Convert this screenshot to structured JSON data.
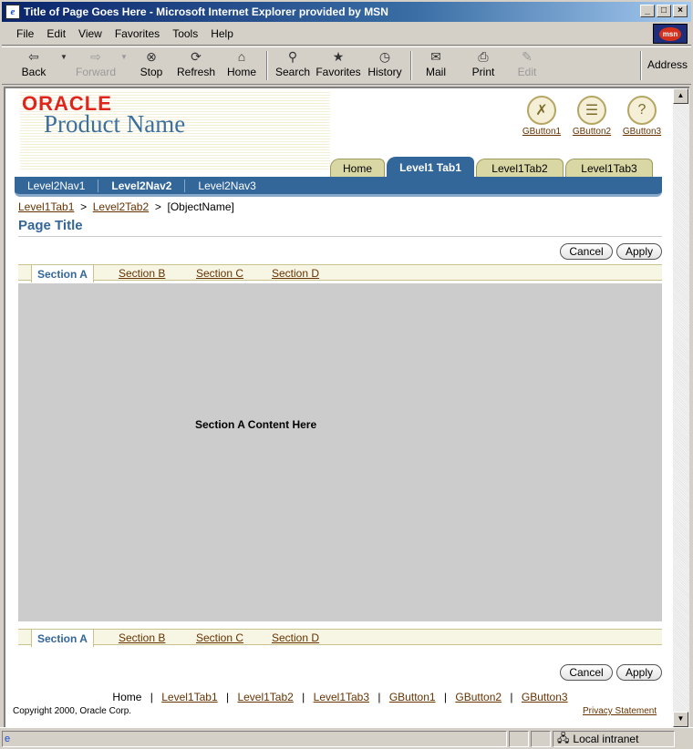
{
  "window": {
    "title": "Title of Page Goes Here - Microsoft Internet Explorer provided by MSN",
    "min": "_",
    "max": "□",
    "close": "×"
  },
  "menu": [
    "File",
    "Edit",
    "View",
    "Favorites",
    "Tools",
    "Help"
  ],
  "msn_label": "msn",
  "toolbar": {
    "back": "Back",
    "forward": "Forward",
    "stop": "Stop",
    "refresh": "Refresh",
    "home": "Home",
    "search": "Search",
    "favorites": "Favorites",
    "history": "History",
    "mail": "Mail",
    "print": "Print",
    "edit": "Edit",
    "address": "Address"
  },
  "status": {
    "zone": "Local intranet"
  },
  "app": {
    "brand": "ORACLE",
    "product": "Product Name",
    "global_buttons": [
      "GButton1",
      "GButton2",
      "GButton3"
    ],
    "level1_tabs": [
      "Home",
      "Level1 Tab1",
      "Level1Tab2",
      "Level1Tab3"
    ],
    "level2_nav": [
      "Level2Nav1",
      "Level2Nav2",
      "Level2Nav3"
    ],
    "breadcrumb": {
      "crumb1": "Level1Tab1",
      "crumb2": "Level2Tab2",
      "sep": ">",
      "current": "[ObjectName]"
    },
    "page_title": "Page Title",
    "cancel": "Cancel",
    "apply": "Apply",
    "sections": [
      "Section A",
      "Section B",
      "Section C",
      "Section D"
    ],
    "content_text": "Section A Content Here",
    "footer_links": [
      "Home",
      "Level1Tab1",
      "Level1Tab2",
      "Level1Tab3",
      "GButton1",
      "GButton2",
      "GButton3"
    ],
    "footer_sep": "|",
    "copyright": "Copyright 2000, Oracle Corp.",
    "privacy": "Privacy Statement"
  }
}
